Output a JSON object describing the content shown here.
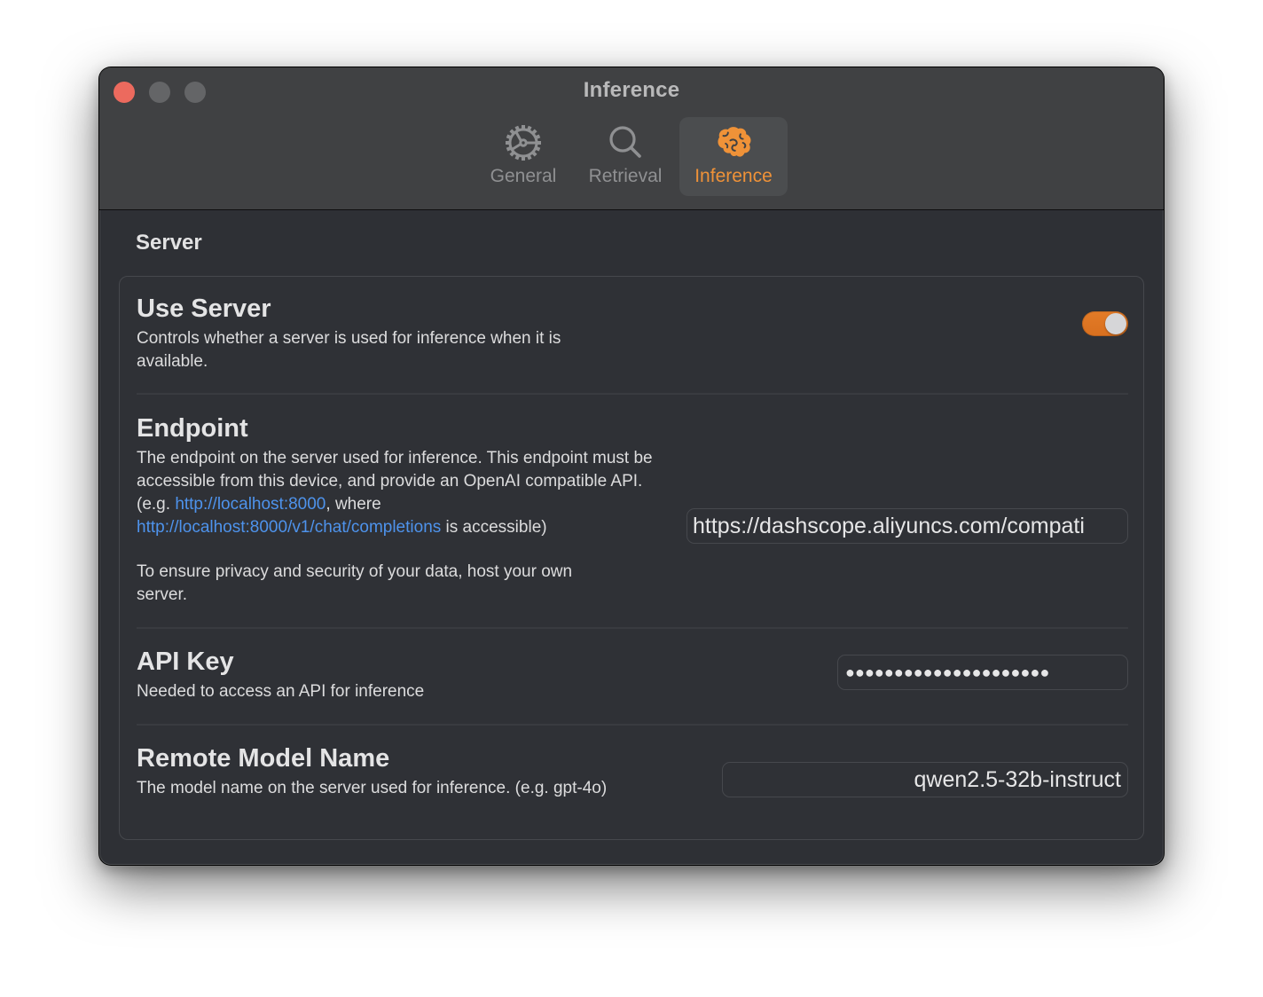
{
  "window": {
    "title": "Inference",
    "traffic_lights": {
      "close": "close-button",
      "minimize": "minimize-button",
      "zoom": "zoom-button"
    }
  },
  "tabs": [
    {
      "label": "General",
      "icon": "gear-icon",
      "selected": false
    },
    {
      "label": "Retrieval",
      "icon": "magnifying-glass-icon",
      "selected": false
    },
    {
      "label": "Inference",
      "icon": "brain-icon",
      "selected": true
    }
  ],
  "colors": {
    "accent": "#ef9238",
    "link": "#4e93ec",
    "toggle_on": "#e37b27"
  },
  "section": {
    "title": "Server"
  },
  "settings": {
    "use_server": {
      "title": "Use Server",
      "description": "Controls whether a server is used for inference when it is available.",
      "enabled": true
    },
    "endpoint": {
      "title": "Endpoint",
      "desc_before_link1": "The endpoint on the server used for inference. This endpoint must be accessible from this device, and provide an OpenAI compatible API. (e.g. ",
      "link1": "http://localhost:8000",
      "desc_between": ", where ",
      "link2": "http://localhost:8000/v1/chat/completions",
      "desc_after": " is accessible)",
      "privacy_note": "To ensure privacy and security of your data, host your own server.",
      "value": "https://dashscope.aliyuncs.com/compati"
    },
    "api_key": {
      "title": "API Key",
      "description": "Needed to access an API for inference",
      "masked_value": "●●●●●●●●●●●●●●●●●●●●●"
    },
    "model_name": {
      "title": "Remote Model Name",
      "description": "The model name on the server used for inference. (e.g. gpt-4o)",
      "value": "qwen2.5-32b-instruct"
    }
  }
}
